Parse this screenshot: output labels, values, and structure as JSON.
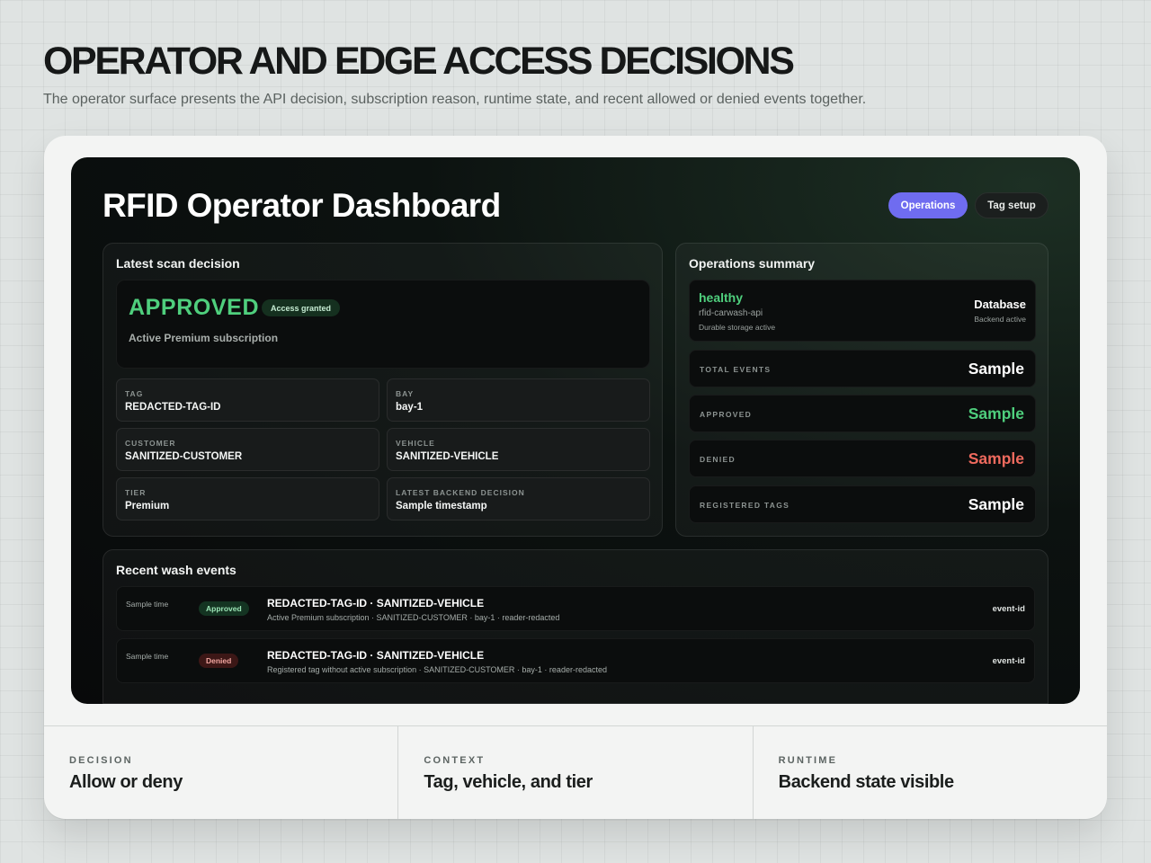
{
  "hero": {
    "title": "OPERATOR AND EDGE ACCESS DECISIONS",
    "subtitle": "The operator surface presents the API decision, subscription reason, runtime state, and recent allowed or denied events together."
  },
  "dashboard": {
    "title": "RFID Operator Dashboard",
    "nav": {
      "operations": "Operations",
      "tag_setup": "Tag setup"
    },
    "latest": {
      "title": "Latest scan decision",
      "status": "APPROVED",
      "badge": "Access granted",
      "reason": "Active Premium subscription",
      "fields": [
        {
          "label": "TAG",
          "value": "REDACTED-TAG-ID"
        },
        {
          "label": "BAY",
          "value": "bay-1"
        },
        {
          "label": "CUSTOMER",
          "value": "SANITIZED-CUSTOMER"
        },
        {
          "label": "VEHICLE",
          "value": "SANITIZED-VEHICLE"
        },
        {
          "label": "TIER",
          "value": "Premium"
        },
        {
          "label": "LATEST BACKEND DECISION",
          "value": "Sample timestamp"
        }
      ]
    },
    "ops": {
      "title": "Operations summary",
      "health": {
        "status": "healthy",
        "service": "rfid-carwash-api",
        "storage": "Durable storage active",
        "db_label": "Database",
        "db_status": "Backend active"
      },
      "stats": [
        {
          "label": "TOTAL EVENTS",
          "value": "Sample"
        },
        {
          "label": "APPROVED",
          "value": "Sample"
        },
        {
          "label": "DENIED",
          "value": "Sample"
        },
        {
          "label": "REGISTERED TAGS",
          "value": "Sample"
        }
      ]
    },
    "recent": {
      "title": "Recent wash events",
      "events": [
        {
          "time": "Sample time",
          "status": "Approved",
          "title": "REDACTED-TAG-ID · SANITIZED-VEHICLE",
          "detail": "Active Premium subscription · SANITIZED-CUSTOMER · bay-1 · reader-redacted",
          "id": "event-id"
        },
        {
          "time": "Sample time",
          "status": "Denied",
          "title": "REDACTED-TAG-ID · SANITIZED-VEHICLE",
          "detail": "Registered tag without active subscription · SANITIZED-CUSTOMER · bay-1 · reader-redacted",
          "id": "event-id"
        }
      ]
    }
  },
  "footer": [
    {
      "label": "DECISION",
      "value": "Allow or deny"
    },
    {
      "label": "CONTEXT",
      "value": "Tag, vehicle, and tier"
    },
    {
      "label": "RUNTIME",
      "value": "Backend state visible"
    }
  ],
  "colors": {
    "accent": "#6f6cf0",
    "approved": "#4fcf7d",
    "denied": "#ef6a5e",
    "page_bg": "#dfe3e2"
  }
}
